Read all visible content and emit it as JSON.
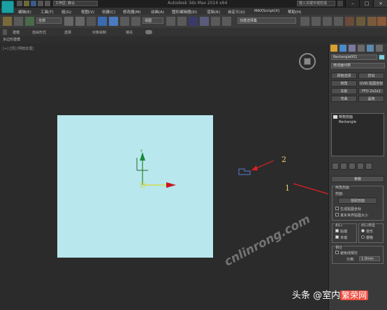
{
  "titlebar": {
    "title": "Autodesk 3ds Max 2014 x64",
    "workspace": "工作区: 默认",
    "search_placeholder": "键入关键字或短语"
  },
  "menu": [
    "编辑(E)",
    "工具(T)",
    "组(G)",
    "视图(V)",
    "创建(C)",
    "修改器(M)",
    "动画(A)",
    "图形编辑器(D)",
    "渲染(R)",
    "自定义(U)",
    "MAXScript(X)",
    "帮助(H)"
  ],
  "toolbar": {
    "selection_filter": "全部",
    "view_dropdown": "视图",
    "selection_set": "创建选择集"
  },
  "ribbon": {
    "tabs": [
      "建模",
      "自由形式",
      "选择",
      "对象绘制",
      "填充"
    ],
    "sub_label": "多边形建模"
  },
  "viewport": {
    "label": "[+] [顶] [明暗处理]",
    "watermark": "cnlinrong.com"
  },
  "command_panel": {
    "object_name": "Rectangle001",
    "modifier_list": "修改器列表",
    "buttons": [
      [
        "网格选择",
        "挤出"
      ],
      [
        "倒角",
        "UVW 贴图坐标"
      ],
      [
        "车削",
        "FFD 2x2x2"
      ],
      [
        "弯曲",
        "晶格"
      ]
    ],
    "stack_items": [
      "倒角剖面",
      "Rectangle"
    ],
    "rollout_title": "参数",
    "profile_group_title": "倒角剖面",
    "profile_label": "剖面:",
    "pick_button": "拾取剖面",
    "options": [
      "生成贴图坐标",
      "真实世界贴图大小"
    ],
    "caps_title": "封口",
    "cap_start": "始端",
    "cap_end": "末端",
    "cap_type_title": "封口类型",
    "cap_type_morph": "变形",
    "cap_type_grid": "栅格",
    "intersect_title": "相交",
    "avoid_intersect": "避免线相交",
    "separation_label": "分离:",
    "separation_value": "1.0mm"
  },
  "annotations": [
    "1",
    "2"
  ],
  "footer": {
    "prefix": "头条 @室内",
    "brand": "繁荣网"
  },
  "colors": {
    "plane": "#b8e7ee",
    "annotation_arrow": "#e02020",
    "annotation_text": "#e8d070"
  }
}
